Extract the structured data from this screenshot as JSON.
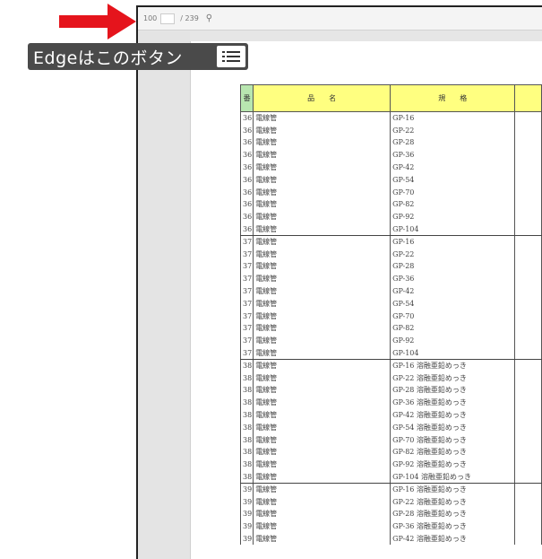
{
  "toolbar": {
    "zoom": "100",
    "page_label": "/ 239",
    "search_icon": "search-icon"
  },
  "tooltip": {
    "text": "Edgeはこのボタン",
    "icon": "list-menu-icon"
  },
  "colors": {
    "arrow": "#e5141c",
    "header_yellow": "#ffff80",
    "header_green": "#b8e6b0",
    "label_bg": "#4a4a4a"
  },
  "table": {
    "headers": [
      "番",
      "品　　名",
      "規　　格"
    ],
    "rows": [
      {
        "no": "36",
        "name": "電線管",
        "spec": "GP-16"
      },
      {
        "no": "36",
        "name": "電線管",
        "spec": "GP-22"
      },
      {
        "no": "36",
        "name": "電線管",
        "spec": "GP-28"
      },
      {
        "no": "36",
        "name": "電線管",
        "spec": "GP-36"
      },
      {
        "no": "36",
        "name": "電線管",
        "spec": "GP-42"
      },
      {
        "no": "36",
        "name": "電線管",
        "spec": "GP-54"
      },
      {
        "no": "36",
        "name": "電線管",
        "spec": "GP-70"
      },
      {
        "no": "36",
        "name": "電線管",
        "spec": "GP-82"
      },
      {
        "no": "36",
        "name": "電線管",
        "spec": "GP-92"
      },
      {
        "no": "36",
        "name": "電線管",
        "spec": "GP-104",
        "end": true
      },
      {
        "no": "37",
        "name": "電線管",
        "spec": "GP-16"
      },
      {
        "no": "37",
        "name": "電線管",
        "spec": "GP-22"
      },
      {
        "no": "37",
        "name": "電線管",
        "spec": "GP-28"
      },
      {
        "no": "37",
        "name": "電線管",
        "spec": "GP-36"
      },
      {
        "no": "37",
        "name": "電線管",
        "spec": "GP-42"
      },
      {
        "no": "37",
        "name": "電線管",
        "spec": "GP-54"
      },
      {
        "no": "37",
        "name": "電線管",
        "spec": "GP-70"
      },
      {
        "no": "37",
        "name": "電線管",
        "spec": "GP-82"
      },
      {
        "no": "37",
        "name": "電線管",
        "spec": "GP-92"
      },
      {
        "no": "37",
        "name": "電線管",
        "spec": "GP-104",
        "end": true
      },
      {
        "no": "38",
        "name": "電線管",
        "spec": "GP-16 溶融亜鉛めっき"
      },
      {
        "no": "38",
        "name": "電線管",
        "spec": "GP-22 溶融亜鉛めっき"
      },
      {
        "no": "38",
        "name": "電線管",
        "spec": "GP-28 溶融亜鉛めっき"
      },
      {
        "no": "38",
        "name": "電線管",
        "spec": "GP-36 溶融亜鉛めっき"
      },
      {
        "no": "38",
        "name": "電線管",
        "spec": "GP-42 溶融亜鉛めっき"
      },
      {
        "no": "38",
        "name": "電線管",
        "spec": "GP-54 溶融亜鉛めっき"
      },
      {
        "no": "38",
        "name": "電線管",
        "spec": "GP-70 溶融亜鉛めっき"
      },
      {
        "no": "38",
        "name": "電線管",
        "spec": "GP-82 溶融亜鉛めっき"
      },
      {
        "no": "38",
        "name": "電線管",
        "spec": "GP-92 溶融亜鉛めっき"
      },
      {
        "no": "38",
        "name": "電線管",
        "spec": "GP-104 溶融亜鉛めっき",
        "end": true
      },
      {
        "no": "39",
        "name": "電線管",
        "spec": "GP-16 溶融亜鉛めっき"
      },
      {
        "no": "39",
        "name": "電線管",
        "spec": "GP-22 溶融亜鉛めっき"
      },
      {
        "no": "39",
        "name": "電線管",
        "spec": "GP-28 溶融亜鉛めっき"
      },
      {
        "no": "39",
        "name": "電線管",
        "spec": "GP-36 溶融亜鉛めっき"
      },
      {
        "no": "39",
        "name": "電線管",
        "spec": "GP-42 溶融亜鉛めっき"
      }
    ]
  }
}
